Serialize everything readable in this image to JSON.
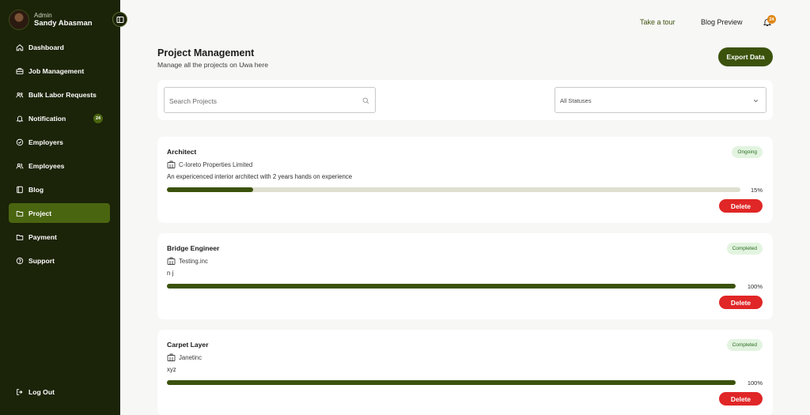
{
  "user": {
    "role": "Admin",
    "name": "Sandy Abasman"
  },
  "sidebar": {
    "items": [
      {
        "label": "Dashboard",
        "icon": "home-icon"
      },
      {
        "label": "Job Management",
        "icon": "briefcase-icon"
      },
      {
        "label": "Bulk Labor Requests",
        "icon": "users-group-icon"
      },
      {
        "label": "Notification",
        "icon": "bell-icon",
        "badge": "24"
      },
      {
        "label": "Employers",
        "icon": "check-circle-icon"
      },
      {
        "label": "Employees",
        "icon": "users-icon"
      },
      {
        "label": "Blog",
        "icon": "book-icon"
      },
      {
        "label": "Project",
        "icon": "folder-icon",
        "active": true
      },
      {
        "label": "Payment",
        "icon": "folder-icon"
      },
      {
        "label": "Support",
        "icon": "help-circle-icon"
      }
    ],
    "logout_label": "Log Out"
  },
  "header": {
    "take_tour": "Take a tour",
    "blog_preview": "Blog Preview",
    "notification_count": "24"
  },
  "page": {
    "title": "Project Management",
    "subtitle": "Manage all the projects on Uwa here",
    "export_label": "Export Data"
  },
  "filters": {
    "search_placeholder": "Search Projects",
    "status_value": "All Statuses"
  },
  "projects": [
    {
      "title": "Architect",
      "company": "C-Ioreto Properties Limited",
      "description": "An expericenced interior architect with 2 years hands on experience",
      "status": "Ongoing",
      "progress": 15,
      "progress_label": "15%",
      "delete_label": "Delete"
    },
    {
      "title": "Bridge Engineer",
      "company": "Testing.inc",
      "description": "n j",
      "status": "Completed",
      "progress": 100,
      "progress_label": "100%",
      "delete_label": "Delete"
    },
    {
      "title": "Carpet Layer",
      "company": "Janetinc",
      "description": "xyz",
      "status": "Completed",
      "progress": 100,
      "progress_label": "100%",
      "delete_label": "Delete"
    }
  ],
  "colors": {
    "sidebar_bg": "#1b2308",
    "accent": "#3b520c",
    "active_nav": "#4a6510",
    "delete": "#e02626",
    "status_pill_bg": "#e2f4e0",
    "notification_badge": "#e0891a"
  }
}
